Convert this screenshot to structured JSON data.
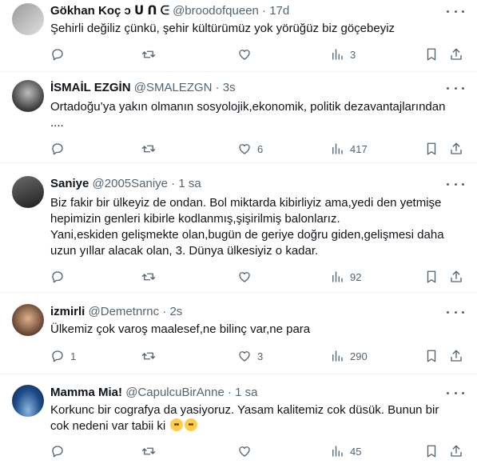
{
  "tweets": [
    {
      "name": "Gökhan Koç ↄ ᑌ ᑎ ᕮ",
      "meta": "@broodofqueen · 17d",
      "text": "Şehirli değiliz çünkü, şehir kültürümüz yok yörüğüz biz göçebeyiz",
      "replies": "",
      "retweets": "",
      "likes": "",
      "views": "3",
      "avatar_colors": [
        "#9a9a9a",
        "#d8d8d8"
      ]
    },
    {
      "name": "İSMAİL EZGİN",
      "meta": "@SMALEZGN · 3s",
      "text": "Ortadoğu’ya yakın olmanın sosyolojik,ekonomik, politik dezavantajlarından\n....",
      "replies": "",
      "retweets": "",
      "likes": "6",
      "views": "417",
      "avatar_colors": [
        "#3a3a3a",
        "#bdbdbd"
      ]
    },
    {
      "name": "Saniye",
      "meta": "@2005Saniye · 1 sa",
      "text": "Biz fakir bir ülkeyiz de ondan. Bol miktarda kibirliyiz ama,yedi den yetmişe\nhepimizin genleri kibirle kodlanmış,şişirilmiş balonlarız.\nYani,eskiden gelişmekte olan,bugün de geriye doğru giden,gelişmesi daha\nuzun yıllar alacak olan, 3. Dünya ülkesiyiz o kadar.",
      "replies": "",
      "retweets": "",
      "likes": "",
      "views": "92",
      "avatar_colors": [
        "#2a2a2a",
        "#6b6b6b"
      ]
    },
    {
      "name": "izmirli",
      "meta": "@Demetnrnc · 2s",
      "text": "Ülkemiz çok varoş maalesef,ne bilinç var,ne para",
      "replies": "1",
      "retweets": "",
      "likes": "3",
      "views": "290",
      "avatar_colors": [
        "#c98a5a",
        "#5a3a2a"
      ]
    },
    {
      "name": "Mamma Mia!",
      "meta": "@CapulcuBirAnne · 1 sa",
      "text": "Korkunc bir cografya da yasiyoruz. Yasam kalitemiz cok düsük. Bunun bir\ncok nedeni var tabii ki ",
      "emoji": [
        "face-with-rolling-eyes",
        "face-with-rolling-eyes"
      ],
      "replies": "",
      "retweets": "",
      "likes": "",
      "views": "45",
      "avatar_colors": [
        "#1f4e8c",
        "#8fb6e0"
      ]
    }
  ],
  "icons": {
    "reply": "reply-icon",
    "retweet": "retweet-icon",
    "like": "heart-icon",
    "views": "views-icon",
    "bookmark": "bookmark-icon",
    "share": "share-icon",
    "more": "more-icon"
  }
}
